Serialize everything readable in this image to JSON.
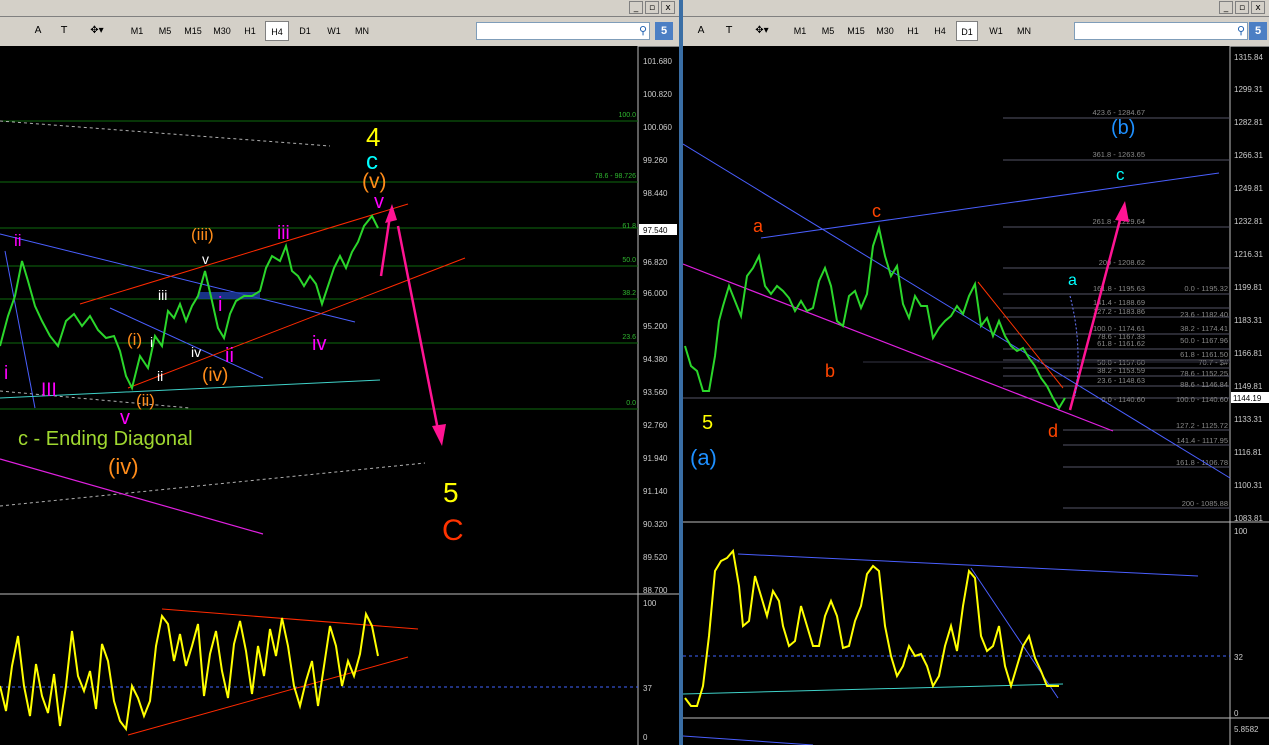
{
  "window_controls": {
    "minimize": "_",
    "restore": "▫",
    "close": "x"
  },
  "toolbar": {
    "font_tool": "A",
    "text_tool": "T",
    "arrow_tool": "✥▾",
    "timeframes": [
      "M1",
      "M5",
      "M15",
      "M30",
      "H1",
      "H4",
      "D1",
      "W1",
      "MN"
    ],
    "search_placeholder": "",
    "badge": "5"
  },
  "left_chart": {
    "active_timeframe": "H4",
    "price_axis": [
      "101.680",
      "100.820",
      "100.060",
      "99.260",
      "98.440",
      "97.540",
      "96.820",
      "96.000",
      "95.200",
      "94.380",
      "93.560",
      "92.760",
      "91.940",
      "91.140",
      "90.320",
      "89.520",
      "88.700"
    ],
    "current_price": "97.540",
    "fib_labels": [
      "100.0",
      "78.6 - 98.726",
      "61.8",
      "50.0",
      "38.2",
      "23.6",
      "0.0"
    ],
    "osc_axis": [
      "100",
      "37",
      "0"
    ],
    "labels": {
      "big_4": "4",
      "big_c": "c",
      "v_paren": "(v)",
      "v_top": "v",
      "iii_paren": "(iii)",
      "iii_magenta": "iii",
      "ii_magenta": "ii",
      "iii_white": "iii",
      "v_white": "v",
      "i_magenta": "i",
      "iv_white": "iv",
      "ii_lower": "ii",
      "i_paren": "(i)",
      "i_white": "i",
      "ii_white": "ii",
      "iv_paren": "(iv)",
      "ii_paren": "(ii)",
      "v_magenta": "v",
      "iv_magenta": "iv",
      "III_magenta": "III",
      "i_left": "i",
      "ending_diagonal": "c - Ending Diagonal",
      "iv_big": "(iv)",
      "big_5": "5",
      "big_C": "C"
    }
  },
  "right_chart": {
    "active_timeframe": "D1",
    "price_axis": [
      "1315.84",
      "1299.31",
      "1282.81",
      "1266.31",
      "1249.81",
      "1232.81",
      "1216.31",
      "1199.81",
      "1183.31",
      "1166.81",
      "1149.81",
      "1144.19",
      "1133.31",
      "1116.81",
      "1100.31",
      "1083.81"
    ],
    "current_price": "1144.19",
    "fib_upper": [
      "423.6 - 1284.67",
      "361.8 - 1263.65",
      "261.8 - 1229.64",
      "200 - 1208.62",
      "161.8 - 1195.63",
      "141.4 - 1188.69",
      "127.2 - 1183.86",
      "100.0 - 1174.61",
      "78.6 - 1167.33",
      "61.8 - 1161.62",
      "50.0 - 1157.60",
      "38.2 - 1153.59",
      "23.6 - 1148.63",
      "0.0 - 1140.60"
    ],
    "fib_mid": [
      "0.0 - 1195.32",
      "23.6 - 1182.40",
      "38.2 - 1174.41",
      "50.0 - 1167.96",
      "61.8 - 1161.50",
      "70.7 - $#",
      "78.6 - 1152.25",
      "88.6 - 1146.84",
      "100.0 - 1140.60"
    ],
    "fib_lower": [
      "127.2 - 1125.72",
      "141.4 - 1117.95",
      "161.8 - 1106.78",
      "200 - 1085.88"
    ],
    "osc_axis": [
      "100",
      "32",
      "0"
    ],
    "bottom_axis": "5.8582",
    "labels": {
      "b_paren": "(b)",
      "c_cyan": "c",
      "c_red": "c",
      "a_red": "a",
      "b_red": "b",
      "a_cyan": "a",
      "d_red": "d",
      "wave5": "5",
      "a_paren": "(a)"
    }
  },
  "colors": {
    "yellow": "#ffff00",
    "cyan": "#00ffff",
    "orange": "#ff8c1a",
    "magenta": "#ff00ff",
    "red": "#ff3300",
    "pink_arrow": "#ff1493",
    "green_candle": "#2bd62b",
    "blue_line": "#4a5fff",
    "grid": "#0e5a0e"
  }
}
